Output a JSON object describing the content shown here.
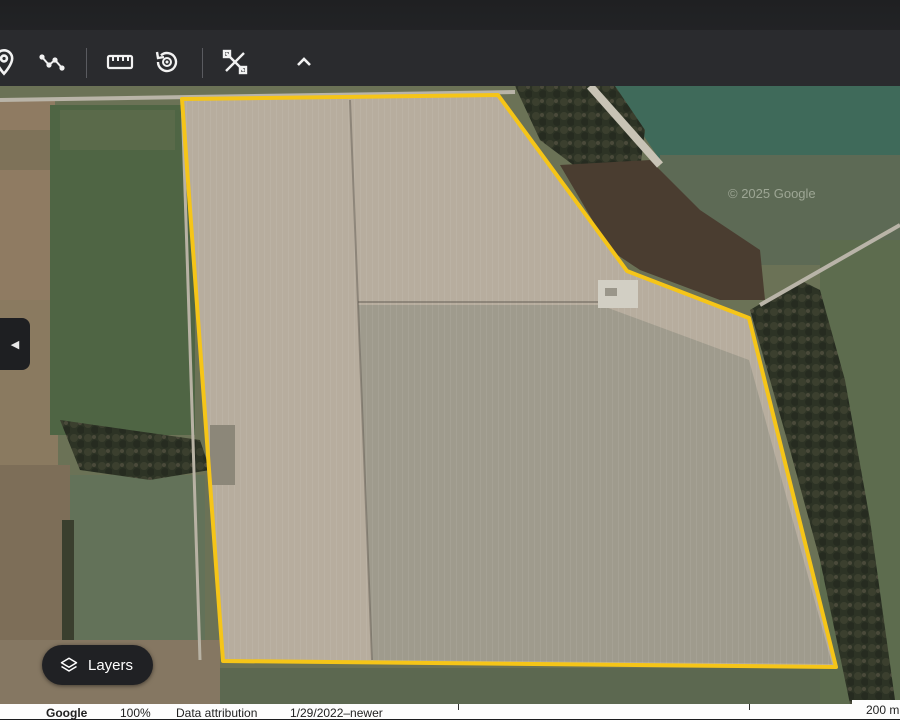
{
  "toolbar": {
    "tools": [
      {
        "icon": "location-pin-icon"
      },
      {
        "icon": "path-icon"
      },
      {
        "icon": "ruler-icon"
      },
      {
        "icon": "historical-imagery-icon"
      },
      {
        "icon": "measure-tools-icon"
      },
      {
        "icon": "collapse-chevron-icon"
      }
    ]
  },
  "map": {
    "watermark": "© 2025 Google",
    "boundary_color": "#f5c518"
  },
  "side_panel": {
    "toggle_icon": "triangle-left-icon",
    "toggle_glyph": "◀"
  },
  "layers_button": {
    "label": "Layers",
    "icon": "layers-icon"
  },
  "status": {
    "brand": "Google",
    "zoom": "100%",
    "attribution": "Data attribution",
    "date": "1/29/2022–newer",
    "scale": "200 m"
  }
}
